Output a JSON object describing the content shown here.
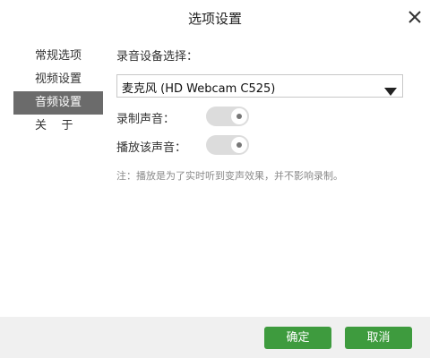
{
  "dialog": {
    "title": "选项设置",
    "close_icon": "close-icon"
  },
  "sidebar": {
    "items": [
      {
        "label": "常规选项",
        "active": false
      },
      {
        "label": "视频设置",
        "active": false
      },
      {
        "label": "音频设置",
        "active": true
      },
      {
        "label": "关    于",
        "active": false
      }
    ]
  },
  "audio": {
    "device_label": "录音设备选择：",
    "device_value": "麦克风 (HD Webcam C525)",
    "dropdown_icon": "caret-down-icon",
    "record_label": "录制声音：",
    "record_on": true,
    "playback_label": "播放该声音：",
    "playback_on": true,
    "note": "注：播放是为了实时听到变声效果，并不影响录制。"
  },
  "footer": {
    "ok_label": "确定",
    "cancel_label": "取消"
  },
  "colors": {
    "accent": "#3e9b3e",
    "sidebar_active": "#6b6b6b",
    "footer_bg": "#f0f0f0"
  }
}
